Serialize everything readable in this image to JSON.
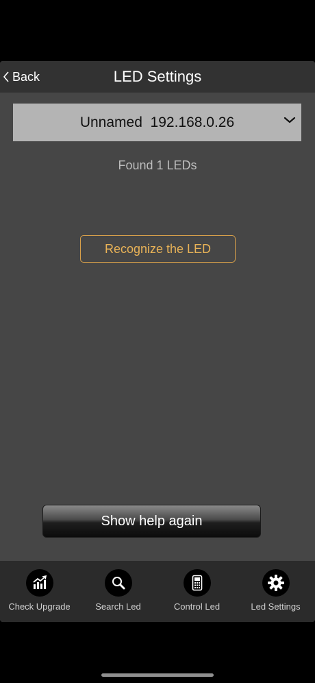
{
  "navbar": {
    "back_label": "Back",
    "title": "LED Settings"
  },
  "device_select": {
    "selected": "Unnamed  192.168.0.26"
  },
  "status": {
    "found_text": "Found 1 LEDs"
  },
  "actions": {
    "recognize_label": "Recognize the LED",
    "help_label": "Show help again"
  },
  "tabbar": {
    "items": [
      {
        "label": "Check Upgrade",
        "icon": "chart-up-icon"
      },
      {
        "label": "Search Led",
        "icon": "search-icon"
      },
      {
        "label": "Control Led",
        "icon": "remote-icon"
      },
      {
        "label": "Led Settings",
        "icon": "gear-icon"
      }
    ]
  },
  "colors": {
    "background": "#464646",
    "navbar": "#323232",
    "accent": "#e8b257",
    "select_bg": "#b4b4b4",
    "tabbar": "#2b2b2b"
  }
}
